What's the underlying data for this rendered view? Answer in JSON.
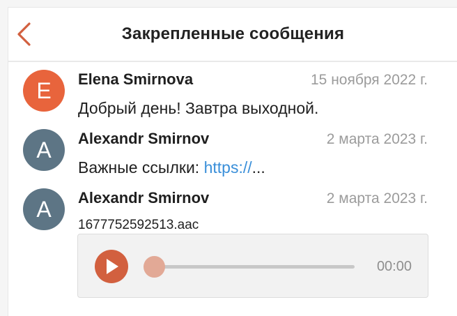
{
  "header": {
    "title": "Закрепленные сообщения"
  },
  "messages": [
    {
      "initial": "E",
      "avatar_color": "#e8643c",
      "sender": "Elena Smirnova",
      "date": "15 ноября 2022 г.",
      "text": "Добрый день! Завтра выходной."
    },
    {
      "initial": "A",
      "avatar_color": "#5d7585",
      "sender": "Alexandr Smirnov",
      "date": "2 марта 2023 г.",
      "text": "Важные ссылки: ",
      "link": "https://",
      "ellipsis": "..."
    },
    {
      "initial": "A",
      "avatar_color": "#5d7585",
      "sender": "Alexandr Smirnov",
      "date": "2 марта 2023 г.",
      "attachment": "1677752592513.aac",
      "audio": {
        "time": "00:00",
        "progress": 0
      }
    }
  ],
  "colors": {
    "accent": "#d2603f",
    "link": "#3a8fd9"
  },
  "icons": {
    "back": "chevron-left-icon",
    "play": "play-icon"
  }
}
